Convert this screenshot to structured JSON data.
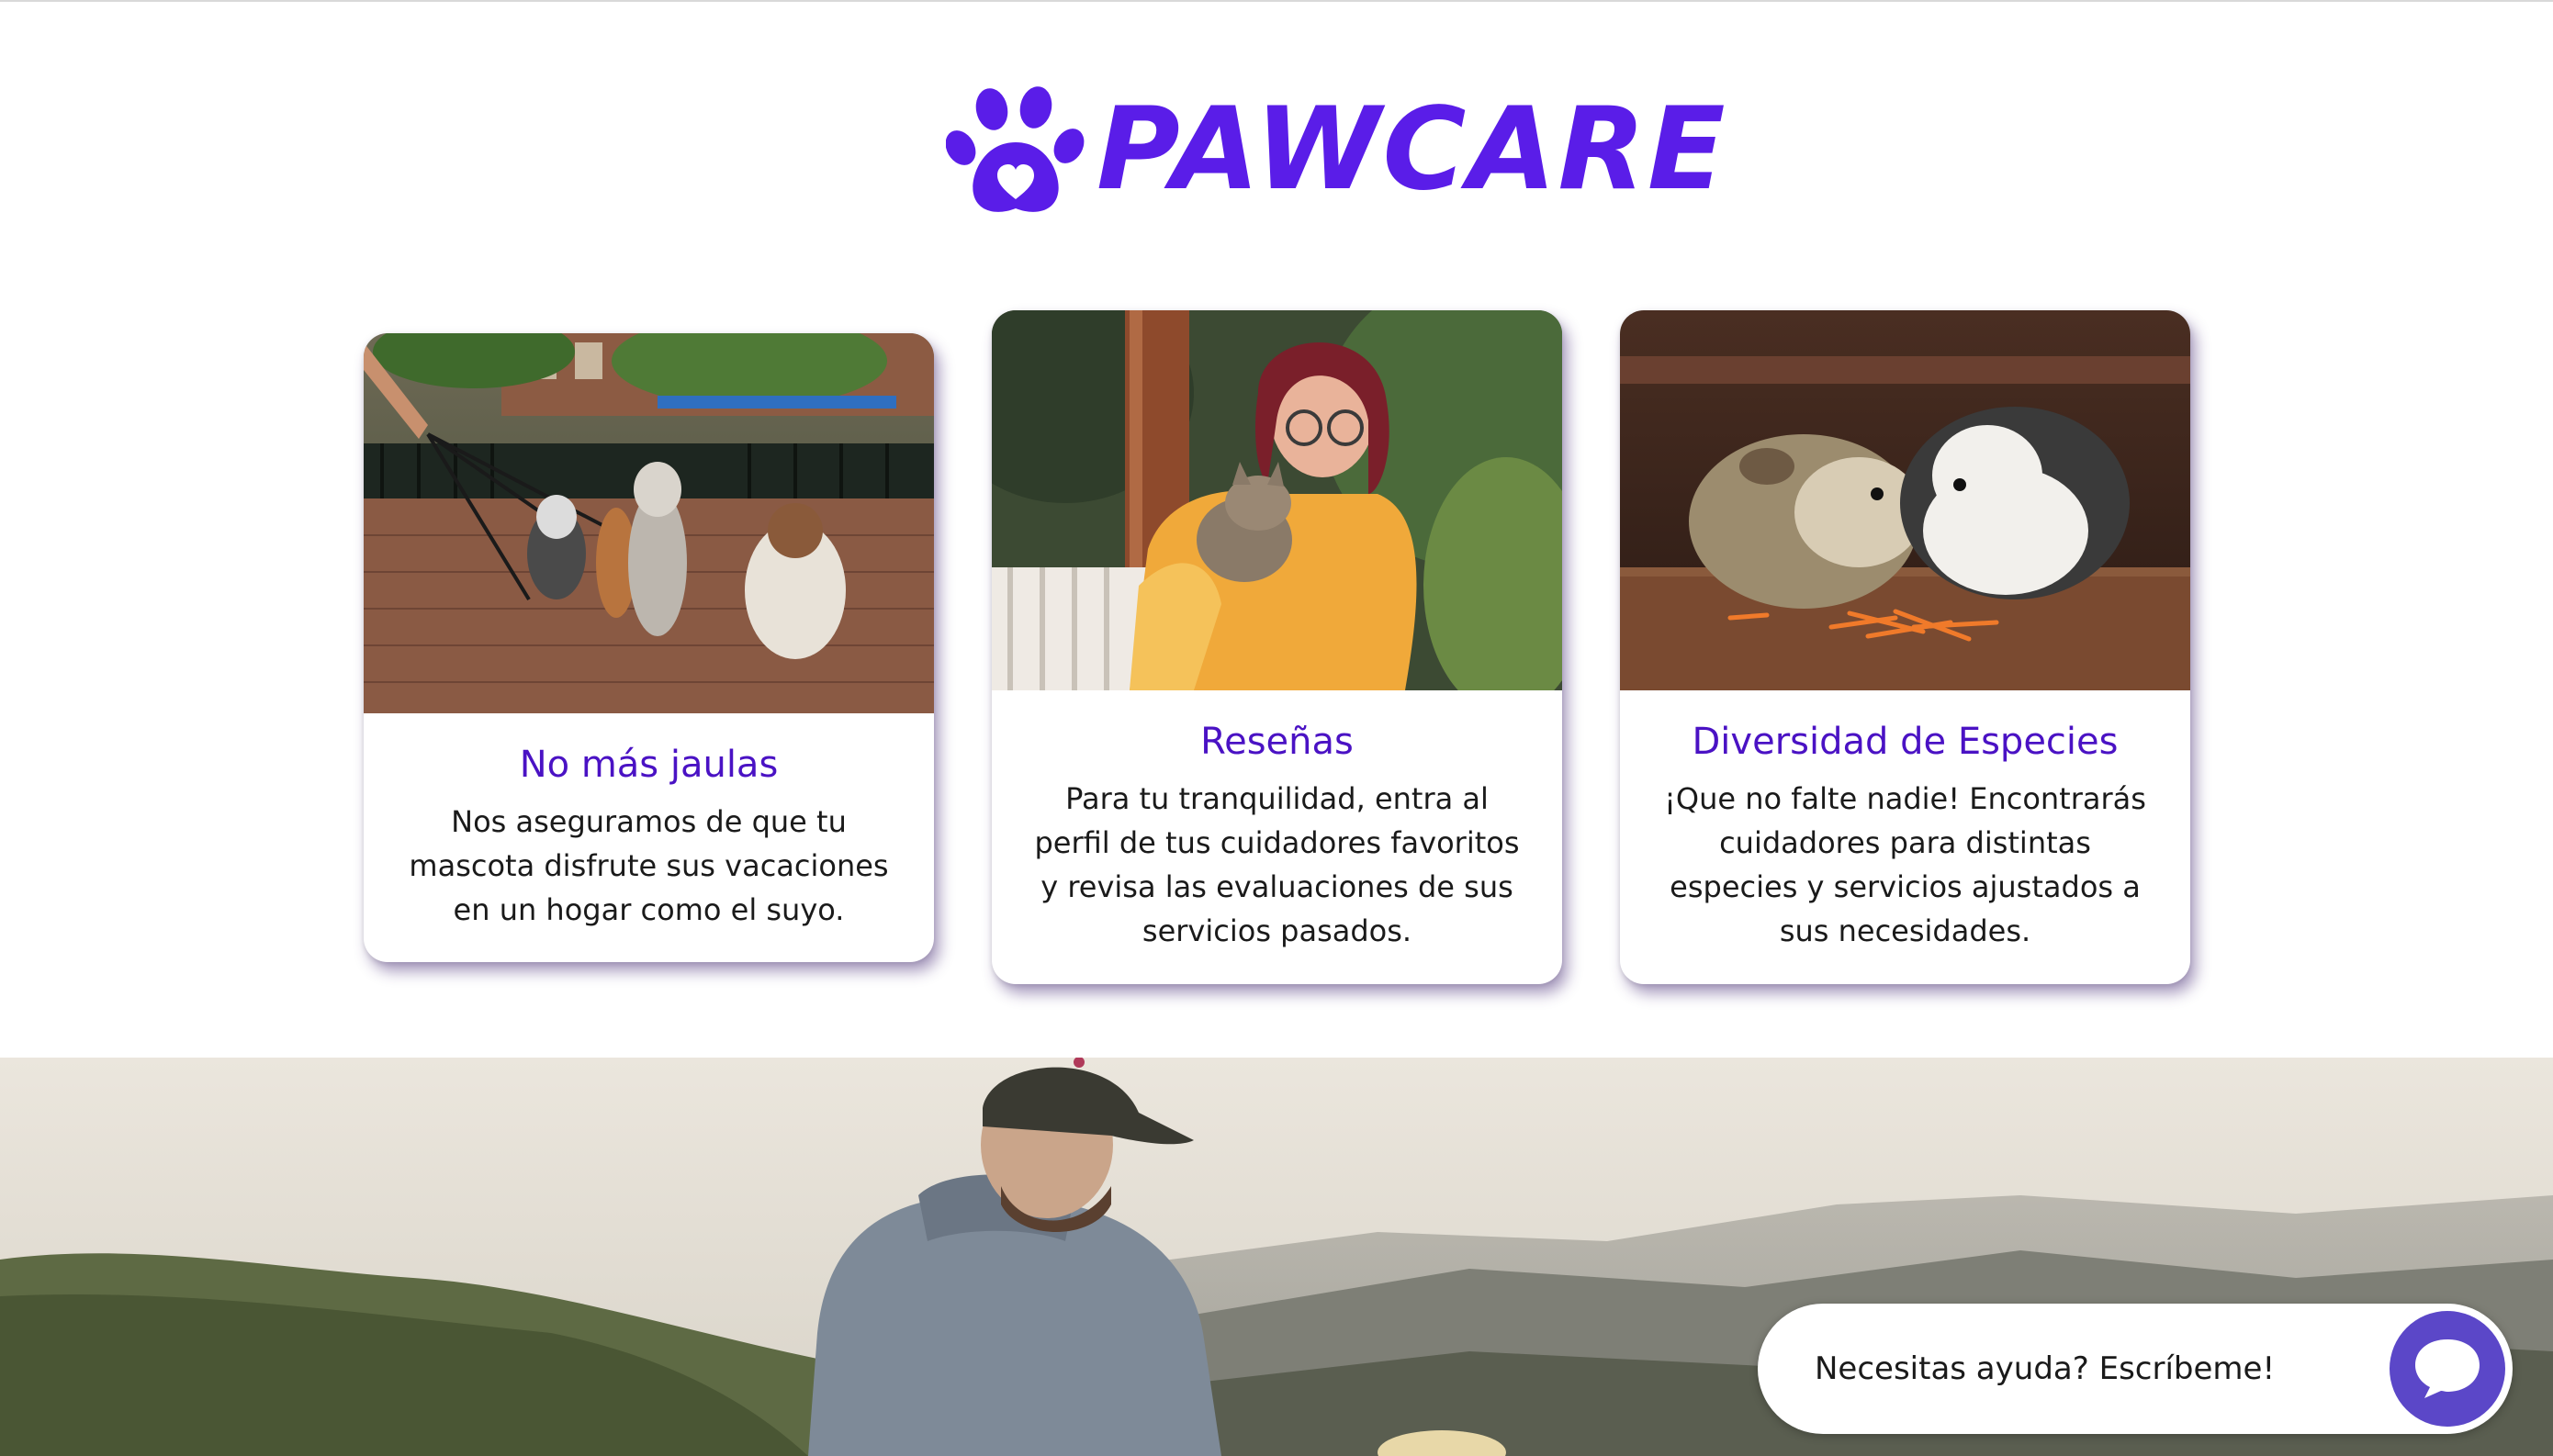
{
  "brand": {
    "name": "PAWCARE",
    "color": "#5a1de8"
  },
  "cards": [
    {
      "title": "No más jaulas",
      "text": "Nos aseguramos de que tu mascota disfrute sus vacaciones en un hogar como el suyo."
    },
    {
      "title": "Reseñas",
      "text": "Para tu tranquilidad, entra al perfil de tus cuidadores favoritos y revisa las evaluaciones de sus servicios pasados."
    },
    {
      "title": "Diversidad de Especies",
      "text": "¡Que no falte nadie! Encontrarás cuidadores para distintas especies y servicios ajustados a sus necesidades."
    }
  ],
  "chat": {
    "label": "Necesitas ayuda? Escríbeme!",
    "icon": "speech-bubble-icon",
    "accent": "#5b47c8"
  },
  "colors": {
    "title": "#4a12c4",
    "text": "#1a1a1a"
  }
}
